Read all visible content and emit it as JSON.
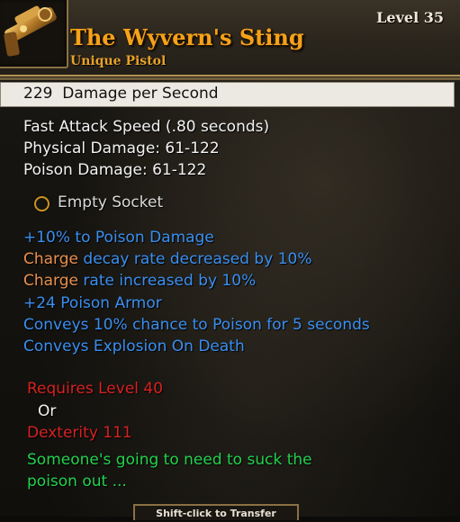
{
  "tooltip": {
    "level": "Level 35",
    "item_name": "The Wyvern's Sting",
    "item_type": "Unique Pistol",
    "dps": "229  Damage per Second",
    "stats": [
      "Fast Attack Speed (.80 seconds)",
      "Physical Damage: 61-122",
      "Poison Damage: 61-122"
    ],
    "socket": "Empty Socket",
    "modifiers": {
      "poison_damage": "+10% to Poison Damage",
      "charge_word": "Charge",
      "charge_decay": "decay rate decreased by 10%",
      "charge_rate": "rate increased by 10%",
      "poison_armor": "+24 Poison Armor",
      "conveys_poison": "Conveys 10% chance to Poison for 5 seconds",
      "conveys_explosion": "Conveys Explosion On Death"
    },
    "requirements": {
      "level": "Requires Level 40",
      "or": "Or",
      "dexterity": "Dexterity 111"
    },
    "flavor_line1": "Someone's going to need to suck the",
    "flavor_line2": "poison out ...",
    "footer": "Shift-click to Transfer"
  },
  "icons": {
    "item": "pistol-icon",
    "socket": "empty-socket-icon"
  },
  "colors": {
    "title": "#f4a21a",
    "modifier": "#3a8ff0",
    "charge": "#e8904e",
    "requirement": "#d42222",
    "flavor": "#22d24c"
  }
}
